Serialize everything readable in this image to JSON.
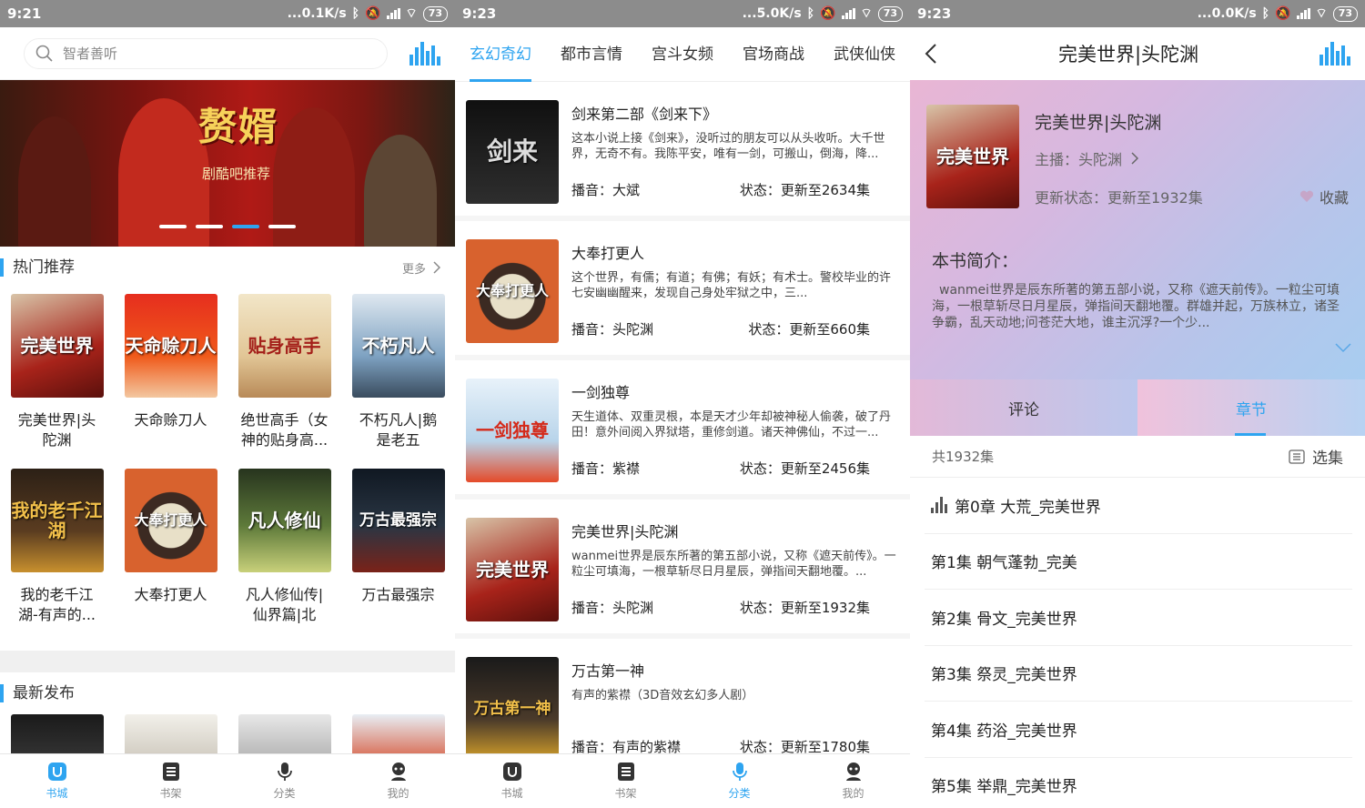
{
  "status_bars": [
    {
      "time": "9:21",
      "speed": "...0.1K/s",
      "battery": "73"
    },
    {
      "time": "9:23",
      "speed": "...5.0K/s",
      "battery": "73"
    },
    {
      "time": "9:23",
      "speed": "...0.0K/s",
      "battery": "73"
    }
  ],
  "colors": {
    "accent": "#2ea4f0"
  },
  "screen1": {
    "search_placeholder": "智者善听",
    "banner": {
      "title": "赘婿",
      "subtitle": "剧酷吧推荐"
    },
    "hot": {
      "title": "热门推荐",
      "more": "更多",
      "items": [
        {
          "name": "完美世界|头陀渊",
          "cover_text": "完美世界"
        },
        {
          "name": "天命赊刀人",
          "cover_text": "天命赊刀人"
        },
        {
          "name": "绝世高手（女神的贴身高...",
          "cover_text": "贴身高手"
        },
        {
          "name": "不朽凡人|鹅是老五",
          "cover_text": "不朽凡人"
        },
        {
          "name": "我的老千江湖-有声的...",
          "cover_text": "我的老千江湖"
        },
        {
          "name": "大奉打更人",
          "cover_text": "大奉打更人"
        },
        {
          "name": "凡人修仙传|仙界篇|北冥...",
          "cover_text": "凡人修仙"
        },
        {
          "name": "万古最强宗",
          "cover_text": "万古最强宗"
        }
      ]
    },
    "latest": {
      "title": "最新发布"
    }
  },
  "screen2": {
    "tabs": [
      "玄幻奇幻",
      "都市言情",
      "宫斗女频",
      "官场商战",
      "武侠仙侠"
    ],
    "books": [
      {
        "title": "剑来第二部《剑来下》",
        "desc": "这本小说上接《剑来》，没听过的朋友可以从头收听。大千世界，无奇不有。我陈平安，唯有一剑，可搬山，倒海，降...",
        "host": "播音：大斌",
        "status": "状态：更新至2634集",
        "cover_text": "剑来"
      },
      {
        "title": "大奉打更人",
        "desc": "这个世界，有儒；有道；有佛；有妖；有术士。警校毕业的许七安幽幽醒来，发现自己身处牢狱之中，三...",
        "host": "播音：头陀渊",
        "status": "状态：更新至660集",
        "cover_text": "大奉打更人"
      },
      {
        "title": "一剑独尊",
        "desc": "天生道体、双重灵根，本是天才少年却被神秘人偷袭，破了丹田！意外间阅入界狱塔，重修剑道。诸天神佛仙，不过一...",
        "host": "播音：紫襟",
        "status": "状态：更新至2456集",
        "cover_text": "一剑独尊"
      },
      {
        "title": "完美世界|头陀渊",
        "desc": "wanmei世界是辰东所著的第五部小说，又称《遮天前传》。一粒尘可填海，一根草斩尽日月星辰，弹指间天翻地覆。...",
        "host": "播音：头陀渊",
        "status": "状态：更新至1932集",
        "cover_text": "完美世界"
      },
      {
        "title": "万古第一神",
        "desc": "有声的紫襟（3D音效玄幻多人剧）",
        "host": "播音：有声的紫襟",
        "status": "状态：更新至1780集",
        "cover_text": "万古第一神"
      }
    ]
  },
  "screen3": {
    "title": "完美世界|头陀渊",
    "book_title": "完美世界|头陀渊",
    "host": "主播：头陀渊",
    "status": "更新状态：更新至1932集",
    "fav": "收藏",
    "intro_label": "本书简介：",
    "intro": "wanmei世界是辰东所著的第五部小说，又称《遮天前传》。一粒尘可填海，一根草斩尽日月星辰，弹指间天翻地覆。群雄并起，万族林立，诸圣争霸，乱天动地;问苍茫大地，谁主沉浮?一个少...",
    "tab_comment": "评论",
    "tab_chapter": "章节",
    "count": "共1932集",
    "select": "选集",
    "episodes": [
      "第0章 大荒_完美世界",
      "第1集 朝气蓬勃_完美",
      "第2集 骨文_完美世界",
      "第3集 祭灵_完美世界",
      "第4集 药浴_完美世界",
      "第5集 举鼎_完美世界"
    ]
  },
  "nav": [
    "书城",
    "书架",
    "分类",
    "我的"
  ]
}
